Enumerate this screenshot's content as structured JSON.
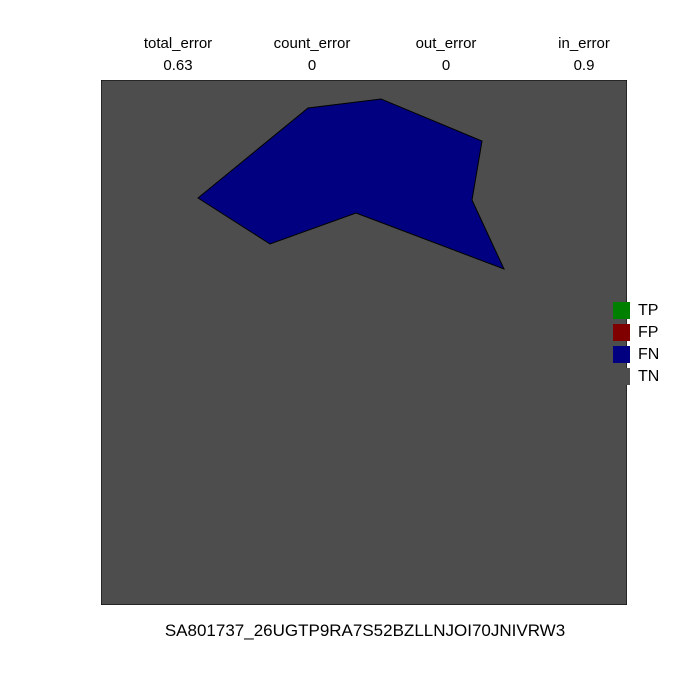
{
  "metrics": [
    {
      "name": "total_error",
      "value": "0.63"
    },
    {
      "name": "count_error",
      "value": "0"
    },
    {
      "name": "out_error",
      "value": "0"
    },
    {
      "name": "in_error",
      "value": "0.9"
    }
  ],
  "legend": [
    {
      "label": "TP",
      "color": "#008000"
    },
    {
      "label": "FP",
      "color": "#800000"
    },
    {
      "label": "FN",
      "color": "#000080"
    },
    {
      "label": "TN",
      "color": "#4d4d4d"
    }
  ],
  "colors": {
    "background": "#4d4d4d",
    "region_fill": "#000080",
    "region_edge": "#000000"
  },
  "caption": "SA801737_26UGTP9RA7S52BZLLNJOI70JNIVRW3"
}
